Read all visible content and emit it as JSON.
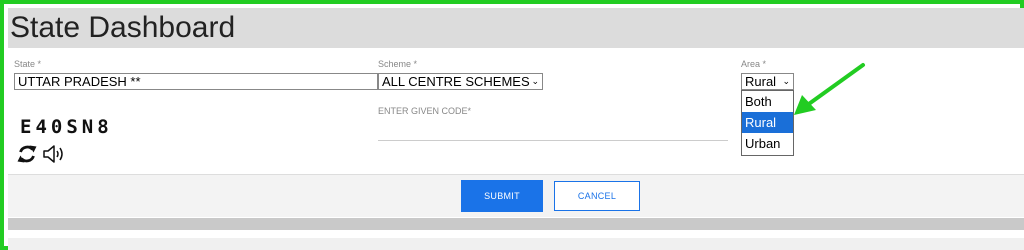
{
  "header": {
    "title": "State Dashboard"
  },
  "form": {
    "state": {
      "label": "State *",
      "value": "UTTAR PRADESH **"
    },
    "scheme": {
      "label": "Scheme *",
      "value": "ALL CENTRE SCHEMES"
    },
    "area": {
      "label": "Area *",
      "value": "Rural",
      "options": [
        "Both",
        "Rural",
        "Urban"
      ],
      "selected_option": "Rural"
    },
    "captcha": {
      "code": "E40SN8",
      "input_label": "ENTER GIVEN CODE*",
      "input_value": ""
    }
  },
  "actions": {
    "submit_label": "SUBMIT",
    "cancel_label": "CANCEL"
  },
  "colors": {
    "accent": "#1a73e8",
    "highlight": "#22cc22",
    "selected_option": "#1a6fd8"
  },
  "icons": {
    "refresh": "refresh-icon",
    "audio": "speaker-icon",
    "annotation": "green-arrow"
  }
}
